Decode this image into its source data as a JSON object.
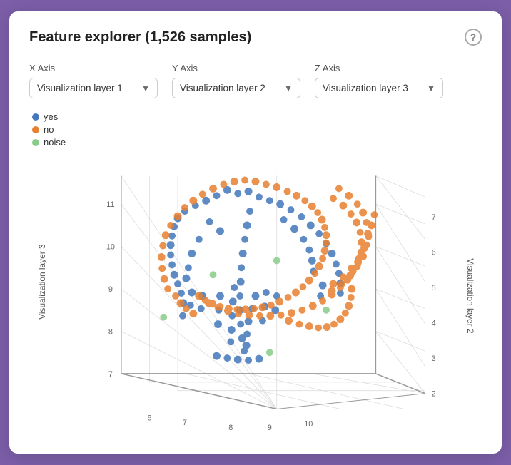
{
  "card": {
    "title": "Feature explorer (1,526 samples)"
  },
  "help": {
    "label": "?"
  },
  "axes": {
    "x": {
      "label": "X Axis",
      "value": "Visualization layer 1"
    },
    "y": {
      "label": "Y Axis",
      "value": "Visualization layer 2"
    },
    "z": {
      "label": "Z Axis",
      "value": "Visualization layer 3"
    }
  },
  "legend": [
    {
      "label": "yes",
      "color": "#4477bb"
    },
    {
      "label": "no",
      "color": "#e88030"
    },
    {
      "label": "noise",
      "color": "#88cc88"
    }
  ],
  "chart": {
    "xAxisLabel": "Visualization layer 1",
    "yAxisLabel": "Visualization layer 3",
    "zAxisLabel": "Visualization layer 2",
    "xTicks": [
      6,
      7,
      8,
      9,
      10
    ],
    "yTicks": [
      7,
      8,
      9,
      10,
      11
    ],
    "zTicks": [
      2,
      3,
      4,
      5,
      6,
      7
    ]
  }
}
